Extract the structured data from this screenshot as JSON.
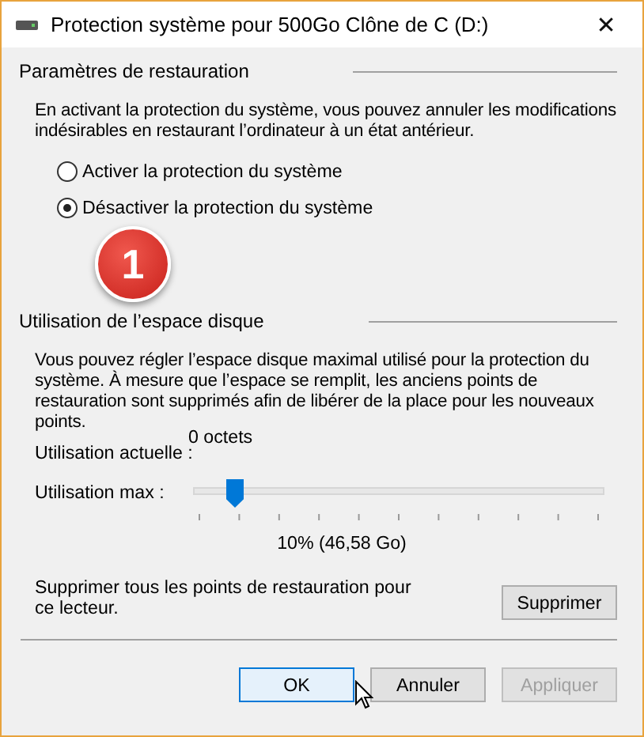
{
  "window": {
    "title": "Protection système pour 500Go Clône de C (D:)",
    "close": "✕"
  },
  "restore_settings": {
    "heading": "Paramètres de restauration",
    "description": "En activant la protection du système, vous pouvez annuler les modifications indésirables en restaurant l’ordinateur à un état antérieur.",
    "options": [
      {
        "label": "Activer la protection du système",
        "selected": false
      },
      {
        "label": "Désactiver la protection du système",
        "selected": true
      }
    ]
  },
  "annotation": {
    "badge": "1"
  },
  "disk_usage": {
    "heading": "Utilisation de l’espace disque",
    "description": "Vous pouvez régler l’espace disque maximal utilisé pour la protection du système. À mesure que l’espace se remplit, les anciens points de restauration sont supprimés afin de libérer de la place pour les nouveaux points.",
    "current_label": "Utilisation actuelle :",
    "current_value": "0 octets",
    "max_label": "Utilisation max :",
    "max_slider": {
      "level": 0.1
    },
    "max_reading": "10% (46,58 Go)",
    "delete_text": "Supprimer tous les points de restauration pour ce lecteur.",
    "delete_button": "Supprimer"
  },
  "buttons": [
    {
      "label": "OK",
      "kind": "default",
      "disabled": false
    },
    {
      "label": "Annuler",
      "kind": "normal",
      "disabled": false
    },
    {
      "label": "Appliquer",
      "kind": "normal",
      "disabled": true
    }
  ]
}
